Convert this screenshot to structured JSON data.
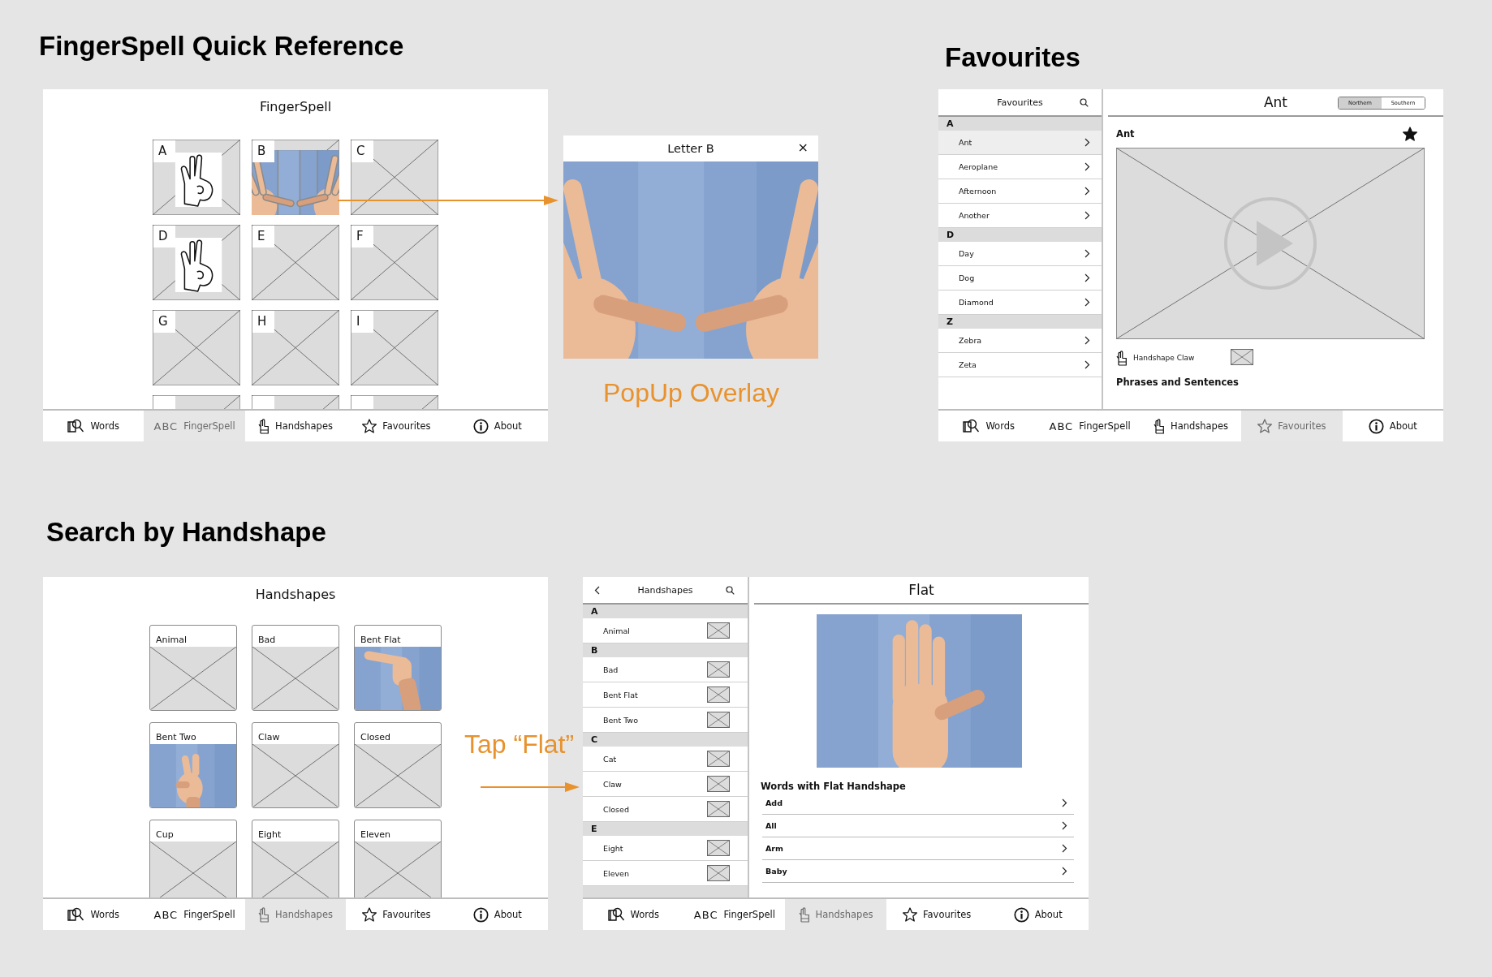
{
  "fingerspell_reference": {
    "heading": "FingerSpell Quick Reference",
    "screen": {
      "title": "FingerSpell",
      "tiles": [
        {
          "label": "A",
          "kind": "drawing"
        },
        {
          "label": "B"
        },
        {
          "label": "C",
          "kind": "placeholder"
        },
        {
          "label": "D",
          "kind": "drawing"
        },
        {
          "label": "E",
          "kind": "placeholder"
        },
        {
          "label": "F",
          "kind": "placeholder"
        },
        {
          "label": "G",
          "kind": "placeholder"
        },
        {
          "label": "H",
          "kind": "placeholder"
        },
        {
          "label": "I",
          "kind": "placeholder"
        },
        {
          "kind": "placeholder"
        },
        {
          "kind": "placeholder"
        },
        {
          "kind": "placeholder"
        }
      ],
      "tab_bar": [
        {
          "label": "Words",
          "selected": false
        },
        {
          "glyph": "ABC",
          "label": "FingerSpell",
          "selected": true
        },
        {
          "label": "Handshapes",
          "selected": false
        },
        {
          "label": "Favourites",
          "selected": false
        },
        {
          "label": "About",
          "selected": false
        }
      ]
    },
    "popup": {
      "title": "Letter B",
      "close": "×"
    },
    "annotation": "PopUp Overlay"
  },
  "favourites": {
    "heading": "Favourites",
    "screen": {
      "list_title": "Favourites",
      "sections": [
        {
          "letter": "A",
          "items": [
            {
              "label": "Ant",
              "selected": true
            },
            {
              "label": "Aeroplane",
              "selected": false
            },
            {
              "label": "Afternoon",
              "selected": false
            },
            {
              "label": "Another",
              "selected": false
            }
          ]
        },
        {
          "letter": "D",
          "items": [
            {
              "label": "Day",
              "selected": false
            },
            {
              "label": "Dog",
              "selected": false
            },
            {
              "label": "Diamond",
              "selected": false
            }
          ]
        },
        {
          "letter": "Z",
          "items": [
            {
              "label": "Zebra",
              "selected": false
            },
            {
              "label": "Zeta",
              "selected": false
            }
          ]
        }
      ],
      "detail": {
        "title": "Ant",
        "region_toggle": [
          {
            "label": "Northern",
            "selected": true
          },
          {
            "label": "Southern",
            "selected": false
          }
        ],
        "word": "Ant",
        "favourited": true,
        "handshape": "Handshape Claw",
        "phrases_heading": "Phrases and Sentences"
      },
      "tab_bar": [
        {
          "label": "Words",
          "selected": false
        },
        {
          "glyph": "ABC",
          "label": "FingerSpell",
          "selected": false
        },
        {
          "label": "Handshapes",
          "selected": false
        },
        {
          "label": "Favourites",
          "selected": true
        },
        {
          "label": "About",
          "selected": false
        }
      ]
    }
  },
  "search_by_handshape": {
    "heading": "Search by Handshape",
    "screen": {
      "title": "Handshapes",
      "tiles": [
        {
          "label": "Animal",
          "kind": "placeholder"
        },
        {
          "label": "Bad",
          "kind": "placeholder"
        },
        {
          "label": "Bent Flat"
        },
        {
          "label": "Bent Two"
        },
        {
          "label": "Claw",
          "kind": "placeholder"
        },
        {
          "label": "Closed",
          "kind": "placeholder"
        },
        {
          "label": "Cup",
          "kind": "placeholder"
        },
        {
          "label": "Eight",
          "kind": "placeholder"
        },
        {
          "label": "Eleven",
          "kind": "placeholder"
        }
      ],
      "tab_bar": [
        {
          "label": "Words",
          "selected": false
        },
        {
          "glyph": "ABC",
          "label": "FingerSpell",
          "selected": false
        },
        {
          "label": "Handshapes",
          "selected": true
        },
        {
          "label": "Favourites",
          "selected": false
        },
        {
          "label": "About",
          "selected": false
        }
      ]
    },
    "annotation": "Tap “Flat”",
    "detail_screen": {
      "list_title": "Handshapes",
      "sections": [
        {
          "letter": "A",
          "items": [
            {
              "label": "Animal"
            }
          ]
        },
        {
          "letter": "B",
          "items": [
            {
              "label": "Bad"
            },
            {
              "label": "Bent Flat"
            },
            {
              "label": "Bent Two"
            }
          ]
        },
        {
          "letter": "C",
          "items": [
            {
              "label": "Cat"
            },
            {
              "label": "Claw"
            },
            {
              "label": "Closed"
            }
          ]
        },
        {
          "letter": "E",
          "items": [
            {
              "label": "Eight"
            },
            {
              "label": "Eleven"
            }
          ]
        }
      ],
      "detail": {
        "title": "Flat",
        "words_heading": "Words with Flat Handshape",
        "words": [
          "Add",
          "All",
          "Arm",
          "Baby"
        ]
      },
      "tab_bar": [
        {
          "label": "Words",
          "selected": false
        },
        {
          "glyph": "ABC",
          "label": "FingerSpell",
          "selected": false
        },
        {
          "label": "Handshapes",
          "selected": true
        },
        {
          "label": "Favourites",
          "selected": false
        },
        {
          "label": "About",
          "selected": false
        }
      ]
    }
  }
}
